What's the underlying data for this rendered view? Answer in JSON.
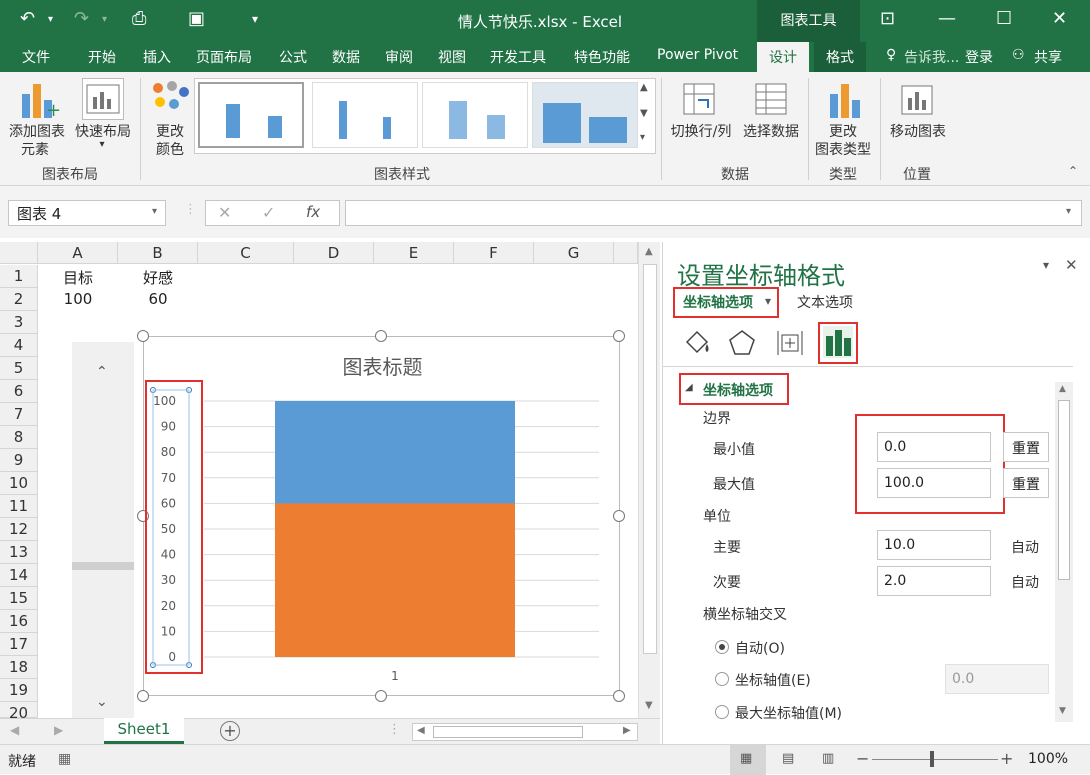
{
  "window": {
    "title": "情人节快乐.xlsx - Excel",
    "context_tab_group": "图表工具"
  },
  "tabs": [
    "文件",
    "开始",
    "插入",
    "页面布局",
    "公式",
    "数据",
    "审阅",
    "视图",
    "开发工具",
    "特色功能",
    "Power Pivot",
    "设计",
    "格式"
  ],
  "tell_me": "告诉我...",
  "login": "登录",
  "share": "共享",
  "ribbon": {
    "add_element": [
      "添加图表",
      "元素"
    ],
    "quick_layout": [
      "快速布局"
    ],
    "change_colors": [
      "更改",
      "颜色"
    ],
    "switch_row_col": "切换行/列",
    "select_data": "选择数据",
    "change_type": [
      "更改",
      "图表类型"
    ],
    "move_chart": "移动图表",
    "groups": [
      "图表布局",
      "图表样式",
      "数据",
      "类型",
      "位置"
    ]
  },
  "formula_bar": {
    "name_box": "图表 4",
    "fx": "fx",
    "value": ""
  },
  "sheet": {
    "columns": [
      "A",
      "B",
      "C",
      "D",
      "E",
      "F",
      "G"
    ],
    "rows": [
      "1",
      "2",
      "3",
      "4",
      "5",
      "6",
      "7",
      "8",
      "9",
      "10",
      "11",
      "12",
      "13",
      "14",
      "15",
      "16",
      "17",
      "18",
      "19",
      "20"
    ],
    "cells": {
      "A1": "目标",
      "B1": "好感",
      "A2": "100",
      "B2": "60"
    }
  },
  "chart_data": {
    "type": "bar",
    "title": "图表标题",
    "categories": [
      "1"
    ],
    "series": [
      {
        "values": [
          100
        ],
        "color": "#5b9bd5"
      },
      {
        "values": [
          60
        ],
        "color": "#ed7d31"
      }
    ],
    "y_ticks": [
      "0",
      "10",
      "20",
      "30",
      "40",
      "50",
      "60",
      "70",
      "80",
      "90",
      "100"
    ],
    "ylim": [
      0,
      100
    ],
    "grid": true,
    "overlap": true
  },
  "sheet_tab": "Sheet1",
  "status": {
    "ready": "就绪",
    "zoom": "100%"
  },
  "pane": {
    "title": "设置坐标轴格式",
    "tab_axis_options": "坐标轴选项",
    "tab_text_options": "文本选项",
    "section": "坐标轴选项",
    "bounds_label": "边界",
    "min_label": "最小值",
    "min_value": "0.0",
    "max_label": "最大值",
    "max_value": "100.0",
    "reset": "重置",
    "units_label": "单位",
    "major_label": "主要",
    "major_value": "10.0",
    "minor_label": "次要",
    "minor_value": "2.0",
    "auto": "自动",
    "cross_label": "横坐标轴交叉",
    "radio_auto": "自动(O)",
    "radio_axis_value": "坐标轴值(E)",
    "axis_value": "0.0",
    "radio_max": "最大坐标轴值(M)"
  }
}
